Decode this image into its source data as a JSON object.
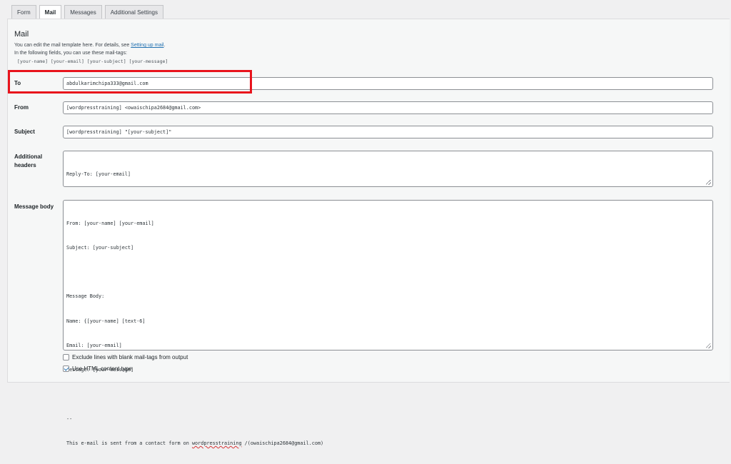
{
  "tabs": [
    {
      "label": "Form",
      "active": false
    },
    {
      "label": "Mail",
      "active": true
    },
    {
      "label": "Messages",
      "active": false
    },
    {
      "label": "Additional Settings",
      "active": false
    }
  ],
  "mail": {
    "heading": "Mail",
    "description_prefix": "You can edit the mail template here. For details, see ",
    "description_link": "Setting up mail",
    "description_suffix": ".",
    "tags_intro": "In the following fields, you can use these mail-tags:",
    "tags": "[your-name] [your-email] [your-subject] [your-message]"
  },
  "fields": {
    "to": {
      "label": "To",
      "value": "abdulkarimchipa333@gmail.com"
    },
    "from": {
      "label": "From",
      "value": "[wordpresstraining] <owaischipa2684@gmail.com>"
    },
    "subject": {
      "label": "Subject",
      "value": "[wordpresstraining] \"[your-subject]\""
    },
    "additional_headers": {
      "label_line1": "Additional",
      "label_line2": "headers",
      "value": "Reply-To: [your-email]"
    },
    "message_body": {
      "label": "Message body",
      "lines": [
        "From: [your-name] [your-email]",
        "Subject: [your-subject]",
        "",
        "Message Body:",
        "Name: {[your-name] [text-6]",
        "Email: [your-email]",
        "Message: [your-message]",
        "",
        "--"
      ],
      "last_line_prefix": "This e-mail is sent from a contact form on ",
      "last_line_site": "wordpresstraining",
      "last_line_suffix": " /(owaischipa2684@gmail.com)"
    }
  },
  "options": {
    "exclude_blank": {
      "label": "Exclude lines with blank mail-tags from output",
      "checked": false
    },
    "html_content": {
      "label": "Use HTML content type",
      "checked": true
    }
  },
  "colors": {
    "highlight": "#e8131c",
    "link": "#2271b1"
  }
}
